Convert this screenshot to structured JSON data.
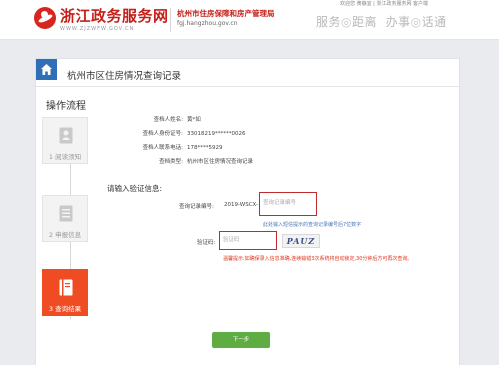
{
  "header": {
    "site_title": "浙江政务服务网",
    "site_url": "WWW.ZJZWFW.GOV.CN",
    "bureau_name": "杭州市住房保障和房产管理局",
    "bureau_url": "fgj.hangzhou.gov.cn",
    "slogan_a": "服务",
    "slogan_b": "距离",
    "slogan_c": "办事",
    "slogan_d": "话通",
    "top_links": "欢迎您 黄静宜 | 浙江政务服务网 客户端"
  },
  "panel": {
    "title": "杭州市区住房情况查询记录",
    "flow_title": "操作流程",
    "steps": [
      {
        "label": "1 阅读须知",
        "icon": "person-card-icon"
      },
      {
        "label": "2 申报信息",
        "icon": "form-icon"
      },
      {
        "label": "3 查询结果",
        "icon": "book-icon"
      }
    ]
  },
  "info": {
    "name_label": "查档人姓名:",
    "name_value": "黄*如",
    "id_label": "查档人身份证号:",
    "id_value": "33018219******0026",
    "phone_label": "查档人联系电话:",
    "phone_value": "178****5929",
    "type_label": "查档类型:",
    "type_value": "杭州市区住房情况查询记录"
  },
  "verify": {
    "section_title": "请输入验证信息:",
    "record_label": "查询记录编号:",
    "record_prefix": "2019-WSCX-",
    "record_placeholder": "查询记录编号",
    "record_hint": "此处输入短信提示的查询记录编号后7位数字",
    "code_label": "验证码:",
    "code_placeholder": "验证码",
    "captcha_text": "PAUZ",
    "warning": "温馨提示:如确保录入信息准确,连续输错3次系统将自动锁定,30分钟后方可再次查询。"
  },
  "actions": {
    "next_label": "下一步"
  },
  "colors": {
    "brand_red": "#c5201a",
    "step_active": "#ef4c24",
    "next_green": "#5fad42",
    "home_blue": "#2f6fb7"
  }
}
